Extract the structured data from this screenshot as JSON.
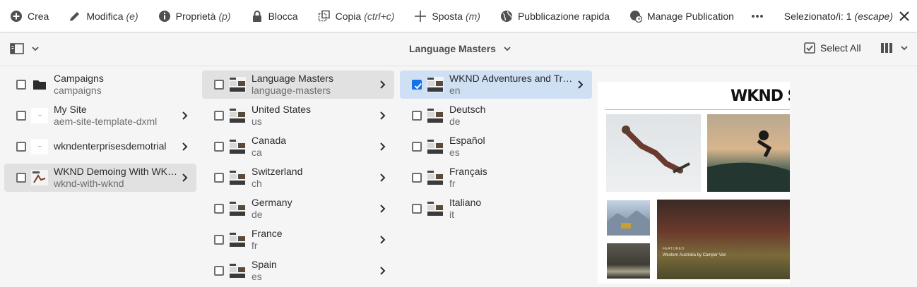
{
  "actionbar": {
    "buttons": [
      {
        "label": "Crea",
        "shortcut": "",
        "icon": "add-circle-icon"
      },
      {
        "label": "Modifica",
        "shortcut": "(e)",
        "icon": "edit-icon"
      },
      {
        "label": "Proprietà",
        "shortcut": "(p)",
        "icon": "info-icon"
      },
      {
        "label": "Blocca",
        "shortcut": "",
        "icon": "lock-icon"
      },
      {
        "label": "Copia",
        "shortcut": "(ctrl+c)",
        "icon": "copy-icon"
      },
      {
        "label": "Sposta",
        "shortcut": "(m)",
        "icon": "move-icon"
      },
      {
        "label": "Pubblicazione rapida",
        "shortcut": "",
        "icon": "globe-icon"
      },
      {
        "label": "Manage Publication",
        "shortcut": "",
        "icon": "globe-clock-icon"
      }
    ],
    "selection_label": "Selezionato/i: 1",
    "selection_shortcut": "(escape)"
  },
  "titlebar": {
    "breadcrumb": "Language Masters",
    "select_all": "Select All"
  },
  "columns": [
    [
      {
        "title": "Campaigns",
        "subtitle": "campaigns",
        "icon": "folder-icon",
        "chevron": false,
        "checked": false
      },
      {
        "title": "My Site",
        "subtitle": "aem-site-template-dxml",
        "icon": "page-icon",
        "chevron": true,
        "checked": false
      },
      {
        "title": "wkndenterprisesdemotrial",
        "subtitle": "",
        "icon": "page-icon",
        "chevron": true,
        "checked": false
      },
      {
        "title": "WKND Demoing With WKND ...",
        "subtitle": "wknd-with-wknd",
        "icon": "thumbnail-icon",
        "chevron": true,
        "checked": false,
        "active": true
      }
    ],
    [
      {
        "title": "Language Masters",
        "subtitle": "language-masters",
        "chevron": true,
        "active": true
      },
      {
        "title": "United States",
        "subtitle": "us",
        "chevron": true
      },
      {
        "title": "Canada",
        "subtitle": "ca",
        "chevron": true
      },
      {
        "title": "Switzerland",
        "subtitle": "ch",
        "chevron": true
      },
      {
        "title": "Germany",
        "subtitle": "de",
        "chevron": true
      },
      {
        "title": "France",
        "subtitle": "fr",
        "chevron": true
      },
      {
        "title": "Spain",
        "subtitle": "es",
        "chevron": true
      }
    ],
    [
      {
        "title": "WKND Adventures and Travel",
        "subtitle": "en",
        "chevron": true,
        "checked": true,
        "selected": true
      },
      {
        "title": "Deutsch",
        "subtitle": "de",
        "chevron": false
      },
      {
        "title": "Español",
        "subtitle": "es",
        "chevron": false
      },
      {
        "title": "Français",
        "subtitle": "fr",
        "chevron": false
      },
      {
        "title": "Italiano",
        "subtitle": "it",
        "chevron": false
      }
    ]
  ],
  "preview": {
    "site_title": "WKND SIT",
    "featured": "FEATURED",
    "caption": "Western Australia by Camper Van"
  },
  "colors": {
    "accent": "#1473e6",
    "selected_row": "#cfe0f5",
    "active_row": "#e1e1e1"
  }
}
